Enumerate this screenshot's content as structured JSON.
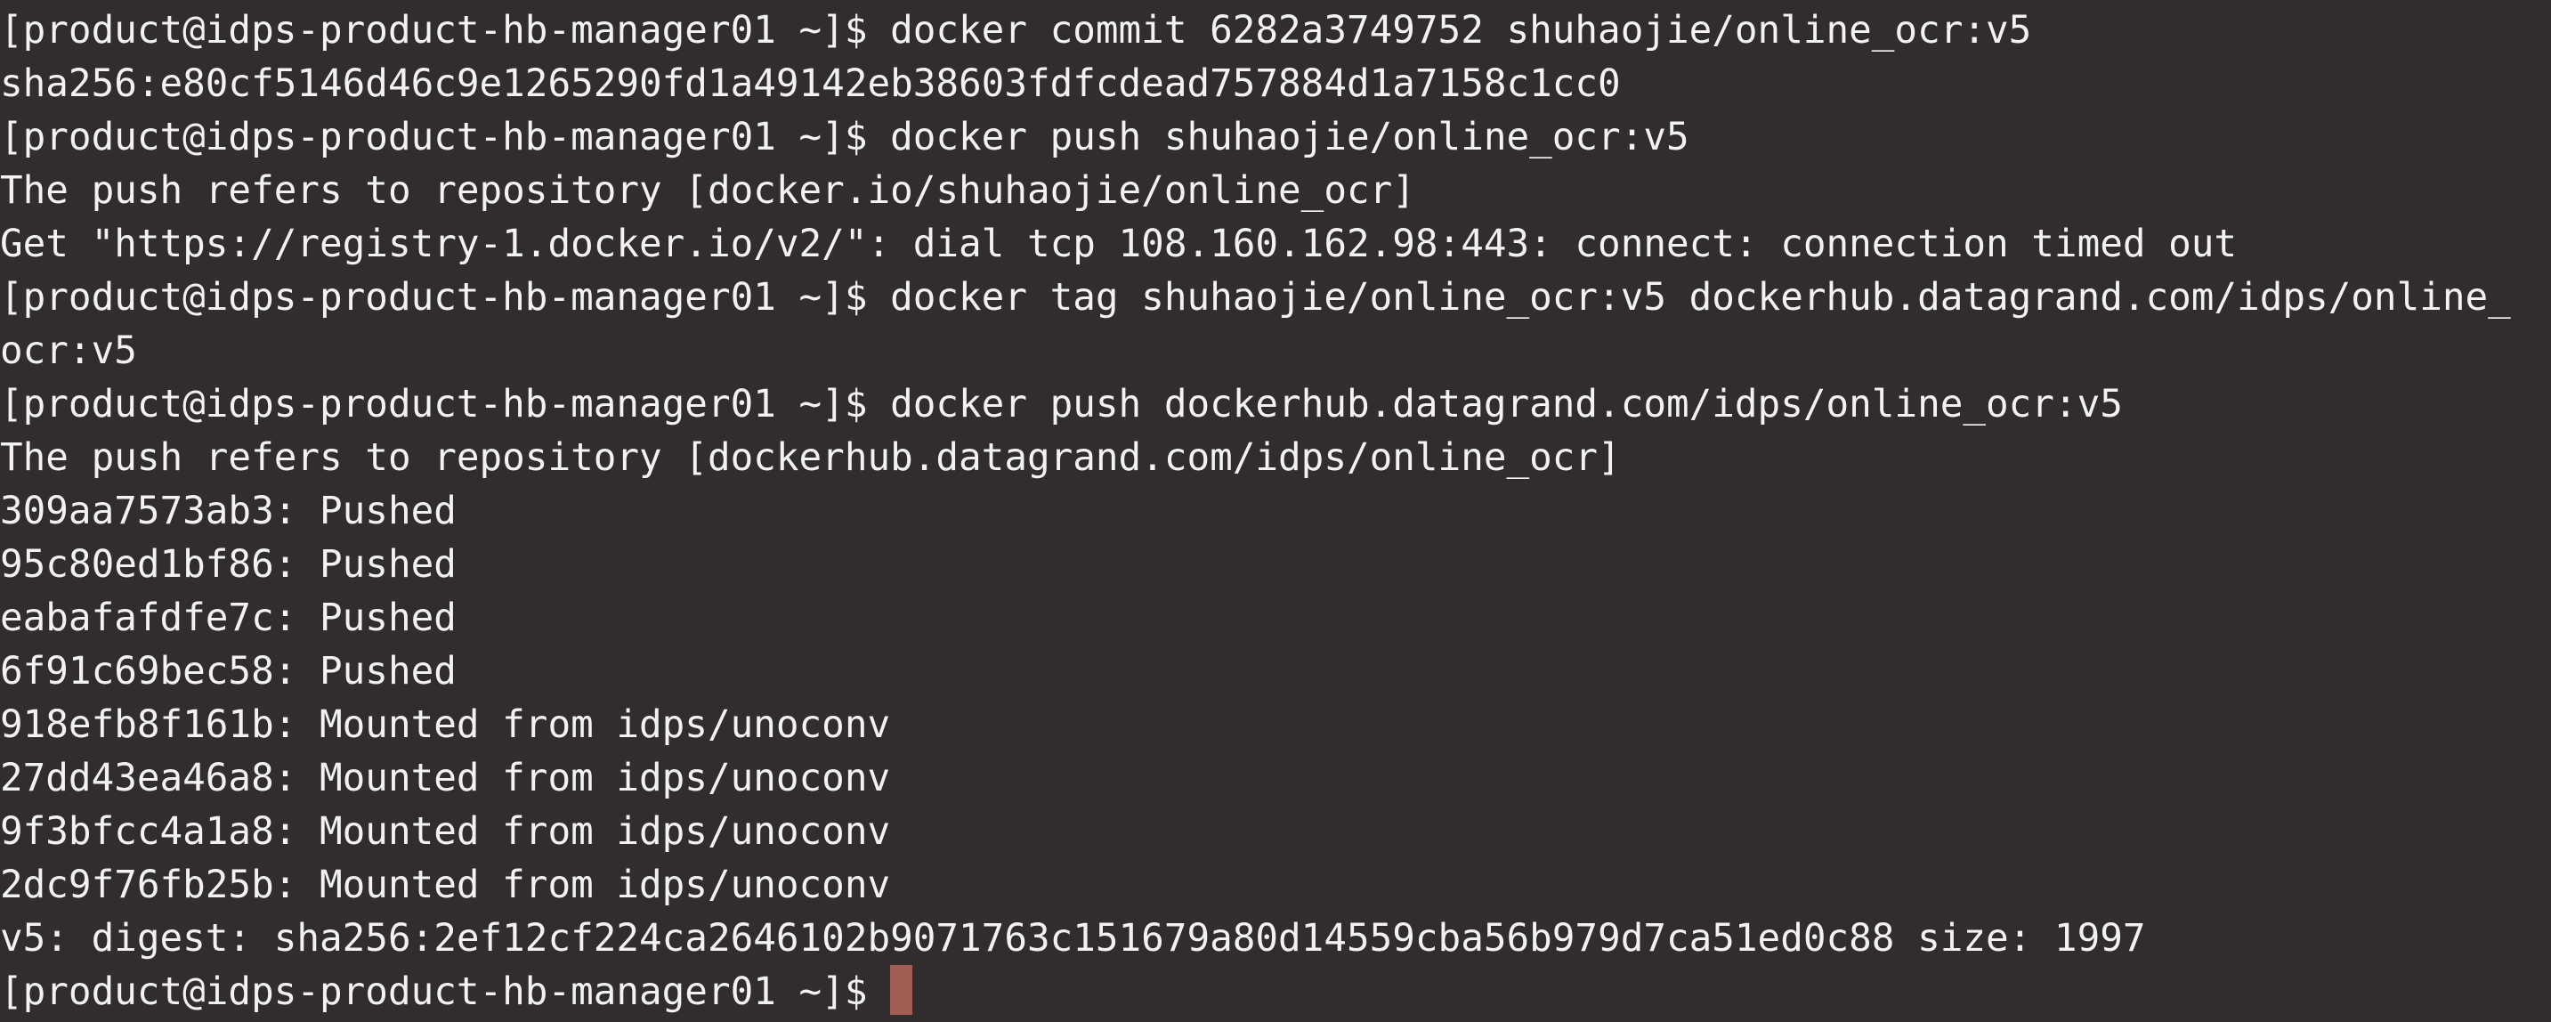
{
  "terminal": {
    "prompt": "[product@idps-product-hb-manager01 ~]$ ",
    "cursor_color": "#a25f51",
    "background": "#312d2d",
    "foreground": "#f2f2f2",
    "lines": [
      "[product@idps-product-hb-manager01 ~]$ docker commit 6282a3749752 shuhaojie/online_ocr:v5",
      "sha256:e80cf5146d46c9e1265290fd1a49142eb38603fdfcdead757884d1a7158c1cc0",
      "[product@idps-product-hb-manager01 ~]$ docker push shuhaojie/online_ocr:v5",
      "The push refers to repository [docker.io/shuhaojie/online_ocr]",
      "Get \"https://registry-1.docker.io/v2/\": dial tcp 108.160.162.98:443: connect: connection timed out",
      "[product@idps-product-hb-manager01 ~]$ docker tag shuhaojie/online_ocr:v5 dockerhub.datagrand.com/idps/online_",
      "ocr:v5",
      "[product@idps-product-hb-manager01 ~]$ docker push dockerhub.datagrand.com/idps/online_ocr:v5",
      "The push refers to repository [dockerhub.datagrand.com/idps/online_ocr]",
      "309aa7573ab3: Pushed",
      "95c80ed1bf86: Pushed",
      "eabafafdfe7c: Pushed",
      "6f91c69bec58: Pushed",
      "918efb8f161b: Mounted from idps/unoconv",
      "27dd43ea46a8: Mounted from idps/unoconv",
      "9f3bfcc4a1a8: Mounted from idps/unoconv",
      "2dc9f76fb25b: Mounted from idps/unoconv",
      "v5: digest: sha256:2ef12cf224ca2646102b9071763c151679a80d14559cba56b979d7ca51ed0c88 size: 1997"
    ]
  }
}
